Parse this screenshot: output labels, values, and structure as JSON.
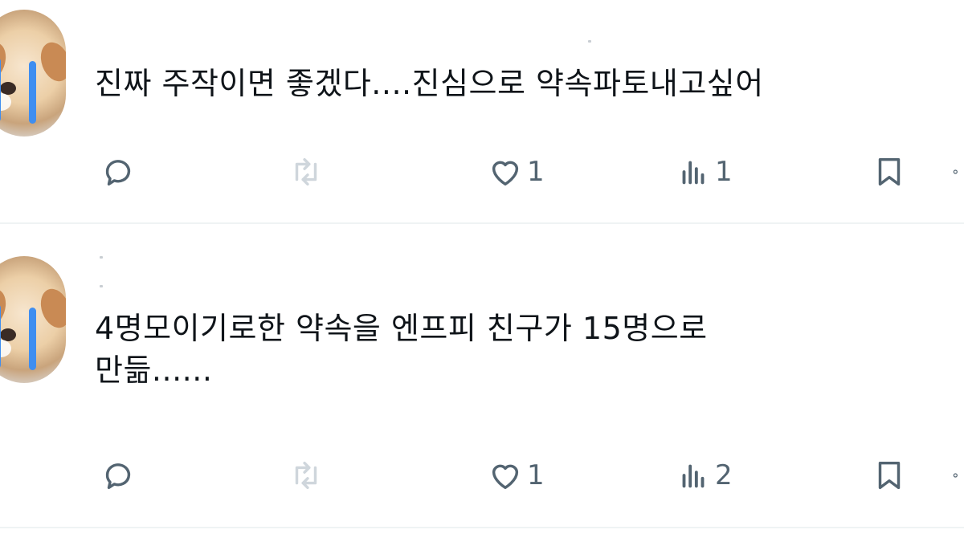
{
  "tweets": [
    {
      "text": "진짜 주작이면 좋겠다....진심으로 약속파토내고싶어",
      "likes": "1",
      "views": "1",
      "replies": "",
      "reposts": ""
    },
    {
      "text": "4명모이기로한 약속을 엔프피 친구가 15명으로\n만듦......",
      "likes": "1",
      "views": "2",
      "replies": "",
      "reposts": ""
    }
  ],
  "icons": {
    "reply": "speech-bubble-icon",
    "repost": "repost-arrows-icon",
    "like": "heart-icon",
    "views": "bar-chart-icon",
    "bookmark": "bookmark-icon",
    "share": "share-icon"
  },
  "colors": {
    "icon_gray": "#536471",
    "divider": "#eff3f4",
    "text": "#0f1419",
    "avatar_tear": "#3f8ef0"
  }
}
